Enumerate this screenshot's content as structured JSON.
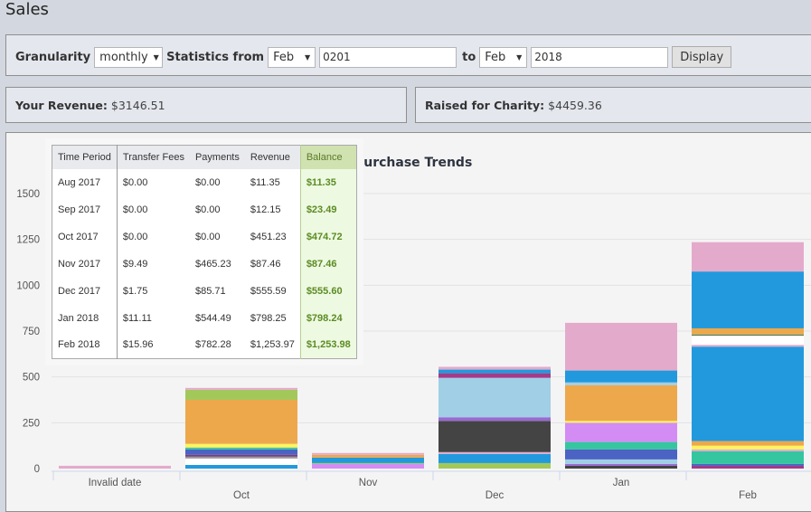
{
  "page": {
    "title": "Sales"
  },
  "filters": {
    "granularity_label": "Granularity",
    "granularity_value": "monthly",
    "statistics_from_label": "Statistics from",
    "from_month": "Feb",
    "from_year": "0201",
    "to_label": "to",
    "to_month": "Feb",
    "to_year": "2018",
    "display_button": "Display"
  },
  "stats": {
    "revenue_label": "Your Revenue:",
    "revenue_value": "$3146.51",
    "charity_label": "Raised for Charity:",
    "charity_value": "$4459.36"
  },
  "table": {
    "headers": [
      "Time Period",
      "Transfer Fees",
      "Payments",
      "Revenue",
      "Balance"
    ],
    "rows": [
      [
        "Aug 2017",
        "$0.00",
        "$0.00",
        "$11.35",
        "$11.35"
      ],
      [
        "Sep 2017",
        "$0.00",
        "$0.00",
        "$12.15",
        "$23.49"
      ],
      [
        "Oct 2017",
        "$0.00",
        "$0.00",
        "$451.23",
        "$474.72"
      ],
      [
        "Nov 2017",
        "$9.49",
        "$465.23",
        "$87.46",
        "$87.46"
      ],
      [
        "Dec 2017",
        "$1.75",
        "$85.71",
        "$555.59",
        "$555.60"
      ],
      [
        "Jan 2018",
        "$11.11",
        "$544.49",
        "$798.25",
        "$798.24"
      ],
      [
        "Feb 2018",
        "$15.96",
        "$782.28",
        "$1,253.97",
        "$1,253.98"
      ]
    ]
  },
  "chart_data": {
    "type": "bar",
    "stacked": true,
    "title": "Purchase Trends",
    "xlabel": "",
    "ylabel": "",
    "ylim": [
      0,
      1500
    ],
    "yticks": [
      0,
      250,
      500,
      750,
      1000,
      1250,
      1500
    ],
    "grid": true,
    "categories": [
      "Invalid date",
      "Oct",
      "Nov",
      "Dec",
      "Jan",
      "Feb"
    ],
    "stacks": [
      [
        {
          "color": "#e4aacb",
          "value": 15
        }
      ],
      [
        {
          "color": "#2299dd",
          "value": 20
        },
        {
          "color": "#ffffff",
          "value": 35
        },
        {
          "color": "#999999",
          "value": 10
        },
        {
          "color": "#7a3d7a",
          "value": 10
        },
        {
          "color": "#4b63c3",
          "value": 30
        },
        {
          "color": "#35c6a0",
          "value": 10
        },
        {
          "color": "#fff45e",
          "value": 20
        },
        {
          "color": "#eda84b",
          "value": 240
        },
        {
          "color": "#a3c85a",
          "value": 55
        },
        {
          "color": "#e4aacb",
          "value": 10
        }
      ],
      [
        {
          "color": "#d38cf4",
          "value": 25
        },
        {
          "color": "#a3c85a",
          "value": 5
        },
        {
          "color": "#2299dd",
          "value": 30
        },
        {
          "color": "#eda84b",
          "value": 15
        },
        {
          "color": "#e4aacb",
          "value": 10
        }
      ],
      [
        {
          "color": "#a3c85a",
          "value": 30
        },
        {
          "color": "#2299dd",
          "value": 50
        },
        {
          "color": "#e4aacb",
          "value": 10
        },
        {
          "color": "#444444",
          "value": 170
        },
        {
          "color": "#9a6ad4",
          "value": 20
        },
        {
          "color": "#a0cfe6",
          "value": 215
        },
        {
          "color": "#a23c88",
          "value": 25
        },
        {
          "color": "#2299dd",
          "value": 20
        },
        {
          "color": "#e4aacb",
          "value": 15
        }
      ],
      [
        {
          "color": "#444444",
          "value": 15
        },
        {
          "color": "#9a6ad4",
          "value": 10
        },
        {
          "color": "#a0cfe6",
          "value": 25
        },
        {
          "color": "#4b63c3",
          "value": 55
        },
        {
          "color": "#35c6a0",
          "value": 40
        },
        {
          "color": "#d38cf4",
          "value": 105
        },
        {
          "color": "#fff45e",
          "value": 10
        },
        {
          "color": "#eda84b",
          "value": 195
        },
        {
          "color": "#a0cfe6",
          "value": 15
        },
        {
          "color": "#2299dd",
          "value": 65
        },
        {
          "color": "#e4aacb",
          "value": 260
        }
      ],
      [
        {
          "color": "#a23c88",
          "value": 15
        },
        {
          "color": "#4b63c3",
          "value": 10
        },
        {
          "color": "#35c6a0",
          "value": 70
        },
        {
          "color": "#e4aacb",
          "value": 10
        },
        {
          "color": "#fff45e",
          "value": 20
        },
        {
          "color": "#eda84b",
          "value": 25
        },
        {
          "color": "#2299dd",
          "value": 515
        },
        {
          "color": "#e4aacb",
          "value": 10
        },
        {
          "color": "#ffffff",
          "value": 50
        },
        {
          "color": "#2a7a6a",
          "value": 5
        },
        {
          "color": "#eda84b",
          "value": 35
        },
        {
          "color": "#2299dd",
          "value": 310
        },
        {
          "color": "#e4aacb",
          "value": 160
        }
      ]
    ],
    "totals": [
      15,
      440,
      85,
      555,
      795,
      1255
    ]
  }
}
